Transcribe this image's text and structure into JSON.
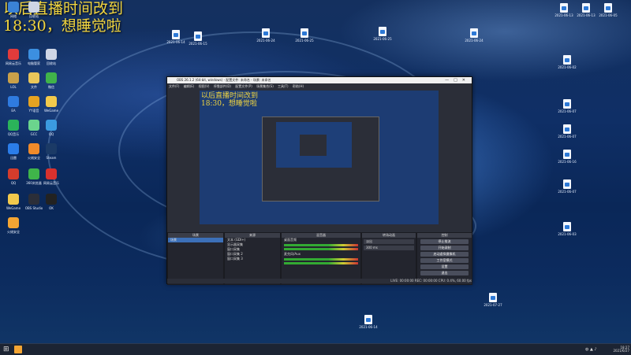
{
  "overlay": {
    "line1": "以后直播时间改到",
    "line2": "18:30，想睡觉啦"
  },
  "desktop_left_icons": [
    {
      "label": "网络",
      "color": "#3b82d6"
    },
    {
      "label": "回收站",
      "color": "#cfd6e6"
    },
    {
      "label": "网易云音乐",
      "color": "#e23b3b"
    },
    {
      "label": "电脑管家",
      "color": "#3c8fe0"
    },
    {
      "label": "回收站",
      "color": "#cfd6e6"
    },
    {
      "label": "LOL",
      "color": "#c9a04a"
    },
    {
      "label": "文件",
      "color": "#e9c65a"
    },
    {
      "label": "微信",
      "color": "#40b34a"
    },
    {
      "label": "EA",
      "color": "#2f7be0"
    },
    {
      "label": "YY语音",
      "color": "#e6a321"
    },
    {
      "label": "WeGame",
      "color": "#f2c94c"
    },
    {
      "label": "QQ音乐",
      "color": "#2bb35a"
    },
    {
      "label": "GCC",
      "color": "#6bd48d"
    },
    {
      "label": "QQ",
      "color": "#3b9be0"
    },
    {
      "label": "迅雷",
      "color": "#2b7de9"
    },
    {
      "label": "火绒安全",
      "color": "#f08a2a"
    },
    {
      "label": "Steam",
      "color": "#1b3a66"
    },
    {
      "label": "QQ",
      "color": "#d43c2c"
    },
    {
      "label": "360浏览器",
      "color": "#3fb44a"
    },
    {
      "label": "网易云音乐",
      "color": "#d8312e"
    },
    {
      "label": "WeGame",
      "color": "#f2c94c"
    },
    {
      "label": "OBS Studio",
      "color": "#2b2e38"
    },
    {
      "label": "OK",
      "color": "#222222"
    },
    {
      "label": "火绒安全",
      "color": "#f4a533"
    }
  ],
  "desktop_files": [
    {
      "label": "2021-06-14"
    },
    {
      "label": "2021-06-15"
    },
    {
      "label": "2021-06-24"
    },
    {
      "label": "2021-06-25"
    },
    {
      "label": "2021-06-25"
    },
    {
      "label": "2021-06-24"
    },
    {
      "label": "2021-06-13"
    },
    {
      "label": "2021-06-13"
    },
    {
      "label": "2021-06-05"
    },
    {
      "label": "2021-06-02"
    },
    {
      "label": "2021-06-07"
    },
    {
      "label": "2021-06-07"
    },
    {
      "label": "2021-06-16"
    },
    {
      "label": "2021-06-07"
    },
    {
      "label": "2021-06-03"
    },
    {
      "label": "2021-07-27"
    },
    {
      "label": "2021-06-14"
    }
  ],
  "obs": {
    "title": "OBS 26.1.2 (64-bit, windows) - 配置文件: 未命名 - 场景: 未命名",
    "menu": [
      "文件(F)",
      "编辑(E)",
      "视图(V)",
      "停靠部件(D)",
      "配置文件(P)",
      "场景集合(S)",
      "工具(T)",
      "帮助(H)"
    ],
    "scenes_header": "场景",
    "scene_item": "场景",
    "sources_header": "来源",
    "sources": [
      "文本 (GDI+)",
      "显示器采集",
      "窗口采集",
      "窗口采集 2",
      "窗口采集 3"
    ],
    "mixer_header": "混音器",
    "mixer_tracks": [
      "桌面音频",
      "麦克风/Aux"
    ],
    "transitions_header": "转场动画",
    "transition_value": "淡出",
    "duration": "300 ms",
    "controls_header": "控制",
    "controls": [
      "停止推流",
      "开始录制",
      "启动虚拟摄像机",
      "工作室模式",
      "设置",
      "退出"
    ],
    "status": "LIVE: 00:00:00   REC: 00:00:00   CPU: 0.4%, 60.00 fps"
  },
  "taskbar": {
    "time": "18:27",
    "date": "2021/6/27"
  }
}
